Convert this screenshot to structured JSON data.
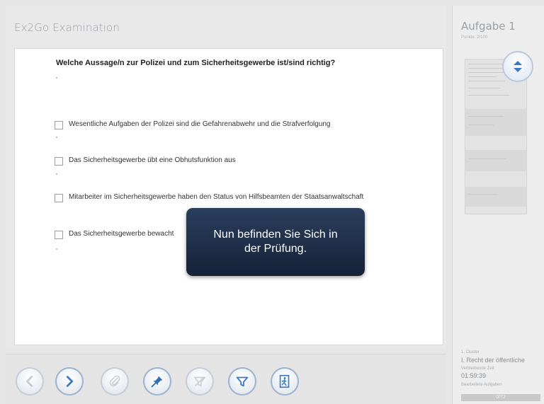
{
  "app": {
    "title": "Ex2Go Examination"
  },
  "question": {
    "text": "Welche Aussage/n zur Polizei und zum Sicherheitsgewerbe ist/sind richtig?",
    "options": [
      {
        "label": "Wesentliche Aufgaben der Polizei sind die Gefahrenabwehr und die Strafverfolgung",
        "checked": false
      },
      {
        "label": "Das Sicherheitsgewerbe übt eine Obhutsfunktion aus",
        "checked": false
      },
      {
        "label": "Mitarbeiter im Sicherheitsgewerbe haben den Status von Hilfsbeamten der Staatsanwaltschaft",
        "checked": false
      },
      {
        "label": "Das Sicherheitsgewerbe bewacht",
        "checked": false
      }
    ]
  },
  "overlay": {
    "message": "Nun befinden Sie Sich in der Prüfung."
  },
  "toolbar": {
    "buttons": [
      {
        "icon": "chevron-left-icon",
        "enabled": false
      },
      {
        "icon": "chevron-right-icon",
        "enabled": true
      },
      {
        "icon": "paperclip-icon",
        "enabled": false
      },
      {
        "icon": "pin-icon",
        "enabled": true
      },
      {
        "icon": "funnel-x-icon",
        "enabled": false
      },
      {
        "icon": "funnel-icon",
        "enabled": true
      },
      {
        "icon": "exit-icon",
        "enabled": true
      }
    ]
  },
  "side": {
    "title": "Aufgabe 1",
    "subtitle": "Punkte: 2/100",
    "cluster_label": "1. Cluster",
    "cluster_name": "I. Recht der öffentliche",
    "time_label": "Verbleibende Zeit",
    "time_value": "01:59:39",
    "done_label": "Bearbeitete Aufgaben",
    "done_value": "0/72",
    "done_fraction": 0
  },
  "colors": {
    "overlay_bg": "#1b2b45",
    "accent": "#3a79c4"
  }
}
